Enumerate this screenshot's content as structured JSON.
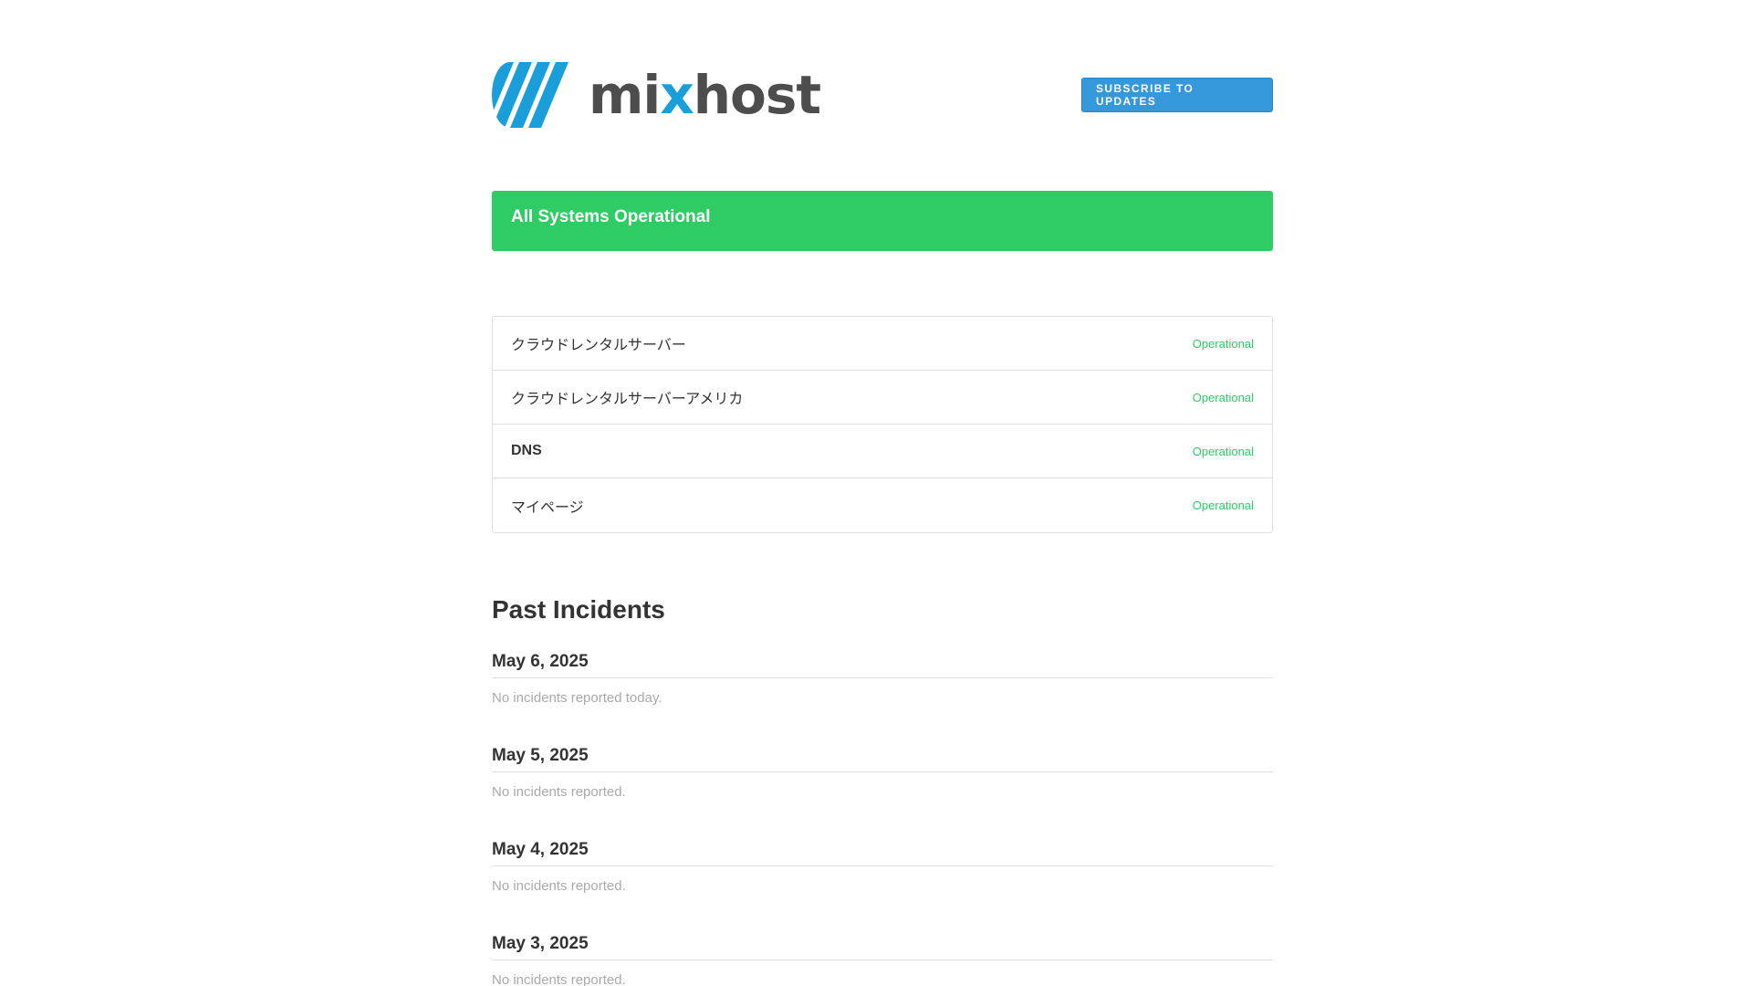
{
  "brand": {
    "name_part1": "mi",
    "name_x": "x",
    "name_part2": "host",
    "mark_icon": "mixhost-stripes-logo",
    "primary_color": "#1a9ed9",
    "text_color": "#4d4d4d"
  },
  "header": {
    "subscribe_label": "SUBSCRIBE TO UPDATES"
  },
  "status": {
    "overall": "All Systems Operational",
    "color": "#2fcc66"
  },
  "components": [
    {
      "name": "クラウドレンタルサーバー",
      "status": "Operational"
    },
    {
      "name": "クラウドレンタルサーバーアメリカ",
      "status": "Operational"
    },
    {
      "name": "DNS",
      "status": "Operational"
    },
    {
      "name": "マイページ",
      "status": "Operational"
    }
  ],
  "past_incidents": {
    "title": "Past Incidents",
    "days": [
      {
        "date": "May 6, 2025",
        "message": "No incidents reported today."
      },
      {
        "date": "May 5, 2025",
        "message": "No incidents reported."
      },
      {
        "date": "May 4, 2025",
        "message": "No incidents reported."
      },
      {
        "date": "May 3, 2025",
        "message": "No incidents reported."
      }
    ]
  }
}
